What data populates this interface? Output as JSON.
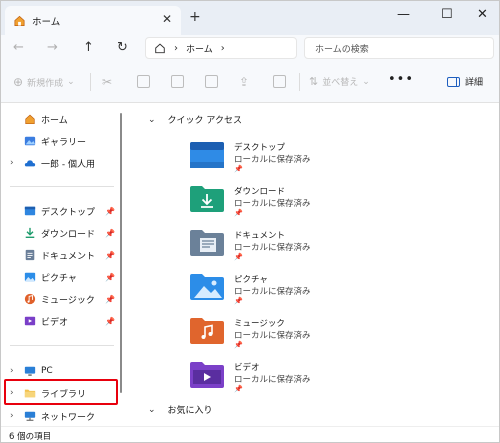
{
  "tab": {
    "title": "ホーム"
  },
  "address": {
    "crumb": "ホーム"
  },
  "search": {
    "placeholder": "ホームの検索"
  },
  "toolbar": {
    "new_label": "新規作成",
    "sort_label": "並べ替え",
    "detail_label": "詳細",
    "more": "•••"
  },
  "sidebar": {
    "top": [
      {
        "label": "ホーム"
      },
      {
        "label": "ギャラリー"
      },
      {
        "label": "一郎 - 個人用"
      }
    ],
    "pinned": [
      {
        "label": "デスクトップ"
      },
      {
        "label": "ダウンロード"
      },
      {
        "label": "ドキュメント"
      },
      {
        "label": "ピクチャ"
      },
      {
        "label": "ミュージック"
      },
      {
        "label": "ビデオ"
      }
    ],
    "bottom": [
      {
        "label": "PC"
      },
      {
        "label": "ライブラリ"
      },
      {
        "label": "ネットワーク"
      }
    ]
  },
  "content": {
    "quick_access": "クイック アクセス",
    "favorites": "お気に入り",
    "folders": [
      {
        "name": "デスクトップ",
        "sub": "ローカルに保存済み"
      },
      {
        "name": "ダウンロード",
        "sub": "ローカルに保存済み"
      },
      {
        "name": "ドキュメント",
        "sub": "ローカルに保存済み"
      },
      {
        "name": "ピクチャ",
        "sub": "ローカルに保存済み"
      },
      {
        "name": "ミュージック",
        "sub": "ローカルに保存済み"
      },
      {
        "name": "ビデオ",
        "sub": "ローカルに保存済み"
      }
    ]
  },
  "status": {
    "count": "6 個の項目"
  },
  "colors": {
    "highlight": "#e8000d",
    "accent": "#1f5fbf"
  }
}
